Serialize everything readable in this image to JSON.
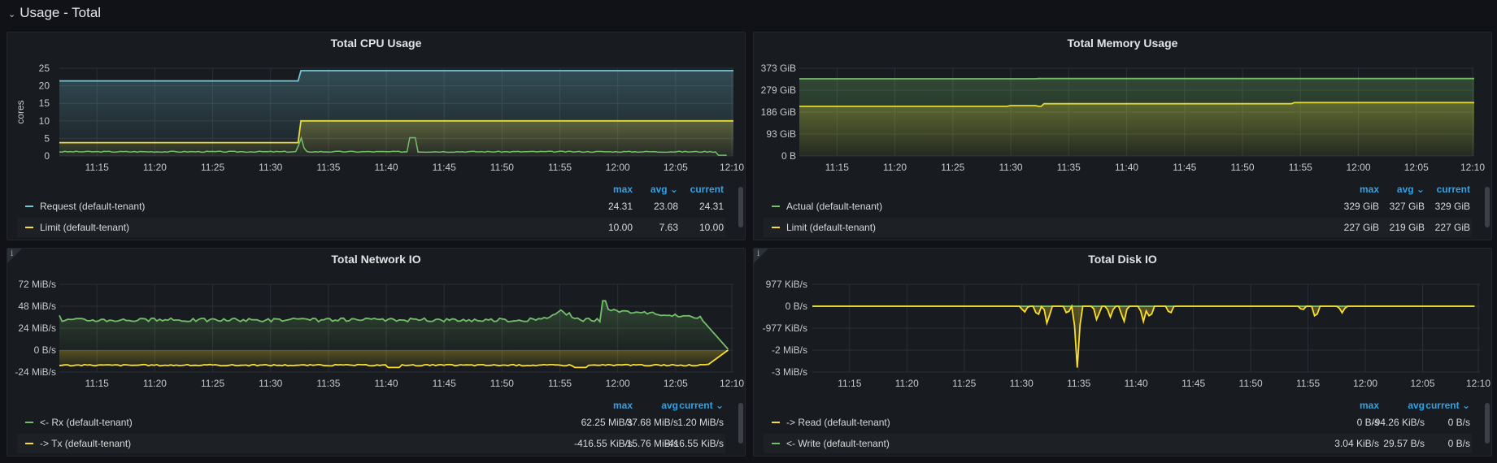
{
  "row": {
    "title": "Usage - Total",
    "chevron": "chevron-down-icon"
  },
  "colors": {
    "green": "#73bf69",
    "yellow": "#fade2a",
    "cyan": "#8ab8ff",
    "blue_link": "#33a2e5",
    "panel_bg": "#181b1f"
  },
  "panels": [
    {
      "id": "cpu",
      "title": "Total CPU Usage",
      "has_info": false,
      "ylabel": "cores",
      "yticks": [
        "25",
        "20",
        "15",
        "10",
        "5",
        "0"
      ],
      "xticks": [
        "11:15",
        "11:20",
        "11:25",
        "11:30",
        "11:35",
        "11:40",
        "11:45",
        "11:50",
        "11:55",
        "12:00",
        "12:05",
        "12:10"
      ],
      "legend_columns": [
        "max",
        "avg",
        "current"
      ],
      "sorted_column": "avg",
      "series": [
        {
          "name": "Request (default-tenant)",
          "color": "#73c7d9",
          "max": "24.31",
          "avg": "23.08",
          "current": "24.31"
        },
        {
          "name": "Limit (default-tenant)",
          "color": "#fade2a",
          "max": "10.00",
          "avg": "7.63",
          "current": "10.00"
        }
      ]
    },
    {
      "id": "mem",
      "title": "Total Memory Usage",
      "has_info": false,
      "ylabel": "",
      "yticks": [
        "373 GiB",
        "279 GiB",
        "186 GiB",
        "93 GiB",
        "0 B"
      ],
      "xticks": [
        "11:15",
        "11:20",
        "11:25",
        "11:30",
        "11:35",
        "11:40",
        "11:45",
        "11:50",
        "11:55",
        "12:00",
        "12:05",
        "12:10"
      ],
      "legend_columns": [
        "max",
        "avg",
        "current"
      ],
      "sorted_column": "avg",
      "series": [
        {
          "name": "Actual (default-tenant)",
          "color": "#73bf69",
          "max": "329 GiB",
          "avg": "327 GiB",
          "current": "329 GiB"
        },
        {
          "name": "Limit (default-tenant)",
          "color": "#fade2a",
          "max": "227 GiB",
          "avg": "219 GiB",
          "current": "227 GiB"
        }
      ]
    },
    {
      "id": "net",
      "title": "Total Network IO",
      "has_info": true,
      "ylabel": "",
      "yticks": [
        "72 MiB/s",
        "48 MiB/s",
        "24 MiB/s",
        "0 B/s",
        "-24 MiB/s"
      ],
      "xticks": [
        "11:15",
        "11:20",
        "11:25",
        "11:30",
        "11:35",
        "11:40",
        "11:45",
        "11:50",
        "11:55",
        "12:00",
        "12:05",
        "12:10"
      ],
      "legend_columns": [
        "max",
        "avg",
        "current"
      ],
      "sorted_column": "current",
      "series": [
        {
          "name": "<- Rx (default-tenant)",
          "color": "#73bf69",
          "max": "62.25 MiB/s",
          "avg": "37.68 MiB/s",
          "current": "1.20 MiB/s"
        },
        {
          "name": "-> Tx (default-tenant)",
          "color": "#fade2a",
          "max": "-416.55 KiB/s",
          "avg": "-15.76 MiB/s",
          "current": "-416.55 KiB/s"
        }
      ]
    },
    {
      "id": "disk",
      "title": "Total Disk IO",
      "has_info": true,
      "ylabel": "",
      "yticks": [
        "977 KiB/s",
        "0 B/s",
        "-977 KiB/s",
        "-2 MiB/s",
        "-3 MiB/s"
      ],
      "xticks": [
        "11:15",
        "11:20",
        "11:25",
        "11:30",
        "11:35",
        "11:40",
        "11:45",
        "11:50",
        "11:55",
        "12:00",
        "12:05",
        "12:10"
      ],
      "legend_columns": [
        "max",
        "avg",
        "current"
      ],
      "sorted_column": "current",
      "series": [
        {
          "name": "-> Read (default-tenant)",
          "color": "#fade2a",
          "max": "0 B/s",
          "avg": "-94.26 KiB/s",
          "current": "0 B/s"
        },
        {
          "name": "<- Write (default-tenant)",
          "color": "#73bf69",
          "max": "3.04 KiB/s",
          "avg": "29.57 B/s",
          "current": "0 B/s"
        }
      ]
    }
  ]
}
